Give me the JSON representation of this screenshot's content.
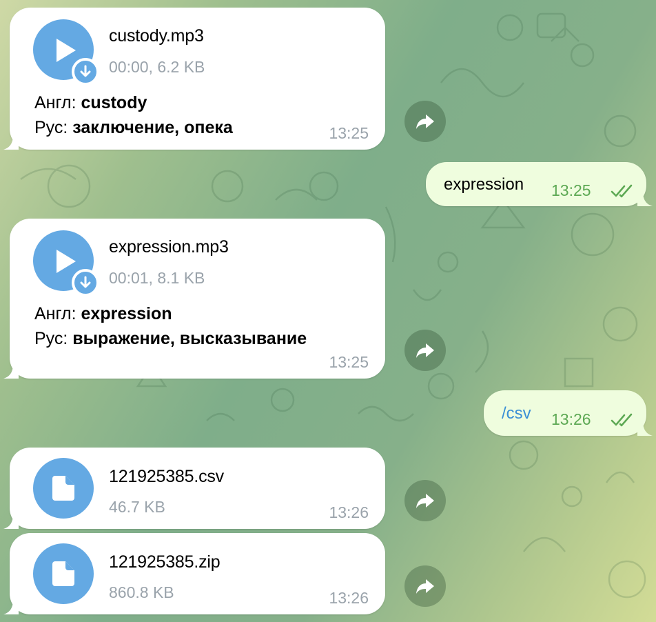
{
  "messages": [
    {
      "type": "audio",
      "file_name": "custody.mp3",
      "meta": "00:00, 6.2 KB",
      "line1_prefix": "Англ: ",
      "line1_value": "custody",
      "line2_prefix": "Рус: ",
      "line2_value": "заключение, опека",
      "time": "13:25"
    },
    {
      "type": "outgoing",
      "text": "expression",
      "time": "13:25"
    },
    {
      "type": "audio",
      "file_name": "expression.mp3",
      "meta": "00:01, 8.1 KB",
      "line1_prefix": "Англ: ",
      "line1_value": "expression",
      "line2_prefix": "Рус: ",
      "line2_value": "выражение, высказывание",
      "time": "13:25"
    },
    {
      "type": "outgoing",
      "text": "/csv",
      "time": "13:26"
    },
    {
      "type": "document",
      "file_name": "121925385.csv",
      "meta": "46.7 KB",
      "time": "13:26"
    },
    {
      "type": "document",
      "file_name": "121925385.zip",
      "meta": "860.8 KB",
      "time": "13:26"
    }
  ],
  "icons": {
    "play": "play-icon",
    "download": "download-arrow-icon",
    "document": "document-icon",
    "forward": "forward-arrow-icon",
    "read": "double-check-icon"
  },
  "colors": {
    "accent_blue": "#64a9e3",
    "outgoing_bubble": "#effdde",
    "outgoing_time": "#5ca853",
    "meta_gray": "#9aa3ab"
  }
}
